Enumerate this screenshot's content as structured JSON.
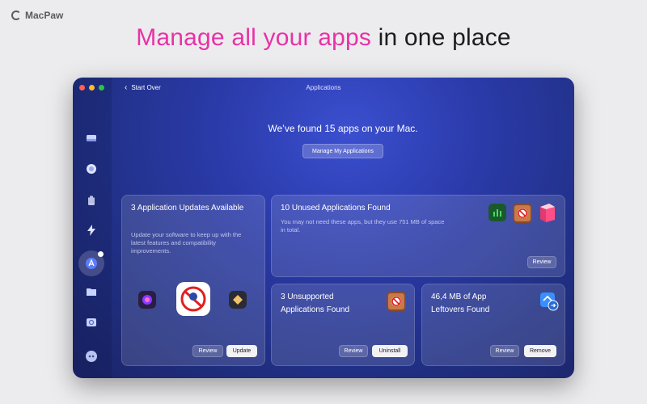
{
  "brand": {
    "name": "MacPaw"
  },
  "headline": {
    "accent": "Manage all your apps",
    "rest": " in one place"
  },
  "window": {
    "nav_back": "Start Over",
    "title": "Applications",
    "found_text": "We’ve found 15 apps on your Mac.",
    "manage_button": "Manage My Applications"
  },
  "sidebar": {
    "items": [
      {
        "icon": "disk-icon"
      },
      {
        "icon": "shield-ball-icon"
      },
      {
        "icon": "hand-icon"
      },
      {
        "icon": "lightning-icon"
      },
      {
        "icon": "applications-icon",
        "active": true
      },
      {
        "icon": "folder-icon"
      },
      {
        "icon": "drive-search-icon"
      },
      {
        "icon": "assistant-icon"
      }
    ]
  },
  "cards": {
    "updates": {
      "title": "3 Application Updates Available",
      "desc": "Update your software to keep up with the latest features and compatibility improvements.",
      "review": "Review",
      "action": "Update"
    },
    "unused": {
      "title": "10 Unused Applications Found",
      "desc": "You may not need these apps, but they use 751 MB of space in total.",
      "review": "Review"
    },
    "unsupported": {
      "title": "3 Unsupported Applications Found",
      "review": "Review",
      "action": "Uninstall"
    },
    "leftovers": {
      "title": "46,4 MB of App Leftovers Found",
      "review": "Review",
      "action": "Remove"
    }
  },
  "colors": {
    "accent_pink": "#e832a6",
    "window_bg": "#2a3aa8",
    "button_solid": "#f2f2f5"
  }
}
